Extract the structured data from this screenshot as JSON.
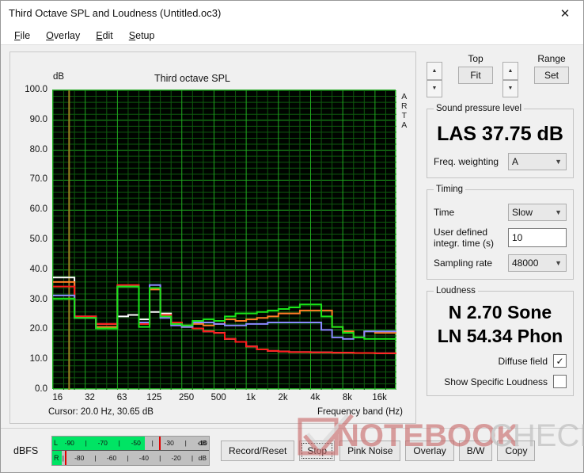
{
  "window": {
    "title": "Third Octave SPL and Loudness (Untitled.oc3)",
    "close_icon": "close-icon",
    "close_glyph": "✕"
  },
  "menu": {
    "items": [
      {
        "accel": "F",
        "rest": "ile"
      },
      {
        "accel": "O",
        "rest": "verlay"
      },
      {
        "accel": "E",
        "rest": "dit"
      },
      {
        "accel": "S",
        "rest": "etup"
      }
    ]
  },
  "graph": {
    "title": "Third octave SPL",
    "y_unit": "dB",
    "watermark_text": "ARTA",
    "cursor_label": "Cursor:   20.0 Hz, 30.65 dB",
    "x_axis_label": "Frequency band (Hz)"
  },
  "controls": {
    "top": {
      "label": "Top",
      "button": "Fit",
      "up_icon": "spinner-up-icon",
      "down_icon": "spinner-down-icon"
    },
    "range": {
      "label": "Range",
      "button": "Set",
      "up_icon": "spinner-up-icon",
      "down_icon": "spinner-down-icon"
    },
    "spl": {
      "legend": "Sound pressure level",
      "value": "LAS 37.75 dB",
      "weighting_label": "Freq. weighting",
      "weighting_value": "A"
    },
    "timing": {
      "legend": "Timing",
      "time_label": "Time",
      "time_value": "Slow",
      "integr_label": "User defined integr. time (s)",
      "integr_value": "10",
      "sampling_label": "Sampling rate",
      "sampling_value": "48000"
    },
    "loudness": {
      "legend": "Loudness",
      "sone": "N 2.70 Sone",
      "phon": "LN 54.34 Phon",
      "diffuse_label": "Diffuse field",
      "diffuse_checked": "✓",
      "specific_label": "Show Specific Loudness",
      "specific_checked": ""
    }
  },
  "meter": {
    "label": "dBFS",
    "left_channel": "L",
    "right_channel": "R",
    "unit": "dB",
    "top_ticks": [
      "-90",
      "|",
      "-70",
      "|",
      "-50",
      "|",
      "-30",
      "|",
      "-10"
    ],
    "bottom_ticks": [
      "|",
      "-80",
      "|",
      "-60",
      "|",
      "-40",
      "|",
      "-20",
      "|"
    ],
    "left_fill_pct": 59,
    "left_peak_pct": 68,
    "right_fill_pct": 6,
    "right_peak_pct": 8
  },
  "buttons": [
    {
      "label": "Record/Reset",
      "focused": false
    },
    {
      "label": "Stop",
      "focused": true
    },
    {
      "label": "Pink Noise",
      "focused": false
    },
    {
      "label": "Overlay",
      "focused": false
    },
    {
      "label": "B/W",
      "focused": false
    },
    {
      "label": "Copy",
      "focused": false
    }
  ],
  "colors": {
    "plot_bg": "#000500",
    "grid_major": "#1fa81f",
    "grid_minor": "#0e5a0e",
    "cursor_line": "#9a8420",
    "series_white": "#ffffff",
    "series_orange": "#ff7d26",
    "series_red": "#ff1a1a",
    "series_blue": "#8a8aff",
    "series_green": "#19e519",
    "meter_green": "#00e464",
    "meter_peak": "#e00000"
  },
  "chart_data": {
    "type": "line",
    "title": "Third octave SPL",
    "xlabel": "Frequency band (Hz)",
    "ylabel": "dB",
    "ylim": [
      0,
      100
    ],
    "ytick_step": 10,
    "yticks": [
      "0.0",
      "10.0",
      "20.0",
      "30.0",
      "40.0",
      "50.0",
      "60.0",
      "70.0",
      "80.0",
      "90.0",
      "100.0"
    ],
    "xticks": [
      "16",
      "32",
      "63",
      "125",
      "250",
      "500",
      "1k",
      "2k",
      "4k",
      "8k",
      "16k"
    ],
    "grid": true,
    "legend": null,
    "step_plot": true,
    "cursor": {
      "freq_hz": 20.0,
      "level_db": 30.65
    },
    "bands_hz": [
      16,
      20,
      25,
      31.5,
      40,
      50,
      63,
      80,
      100,
      125,
      160,
      200,
      250,
      315,
      400,
      500,
      630,
      800,
      1000,
      1250,
      1600,
      2000,
      2500,
      3150,
      4000,
      5000,
      6300,
      8000,
      10000,
      12500,
      16000,
      20000
    ],
    "series": [
      {
        "name": "white",
        "color": "#ffffff",
        "values": [
          37.5,
          37.5,
          24.5,
          24.5,
          22.0,
          22.0,
          24.5,
          25.0,
          23.5,
          26.0,
          25.5,
          22.5,
          21.0,
          20.5,
          19.5,
          19.0,
          17.0,
          16.0,
          14.5,
          13.5,
          13.0,
          12.8,
          12.6,
          12.6,
          12.5,
          12.5,
          12.4,
          12.4,
          12.3,
          12.3,
          12.2,
          12.2
        ]
      },
      {
        "name": "orange",
        "color": "#ff7d26",
        "values": [
          36.0,
          36.0,
          24.0,
          24.0,
          21.0,
          21.0,
          34.5,
          34.5,
          22.0,
          33.5,
          24.5,
          22.0,
          21.5,
          22.0,
          21.5,
          22.0,
          23.5,
          23.0,
          23.5,
          24.0,
          24.5,
          25.5,
          25.5,
          26.5,
          26.5,
          26.5,
          21.0,
          19.5,
          17.5,
          19.5,
          19.0,
          19.0
        ]
      },
      {
        "name": "red",
        "color": "#ff1a1a",
        "values": [
          34.5,
          34.5,
          24.5,
          24.5,
          22.0,
          22.0,
          35.0,
          35.0,
          22.0,
          34.0,
          25.0,
          22.5,
          21.0,
          20.5,
          19.5,
          19.0,
          17.0,
          16.0,
          14.5,
          13.5,
          13.0,
          12.8,
          12.6,
          12.6,
          12.5,
          12.5,
          12.4,
          12.4,
          12.3,
          12.3,
          12.2,
          12.2
        ]
      },
      {
        "name": "blue",
        "color": "#8a8aff",
        "values": [
          31.5,
          31.5,
          24.0,
          24.0,
          20.5,
          20.5,
          34.5,
          34.5,
          22.5,
          35.0,
          24.0,
          21.5,
          21.0,
          22.5,
          22.5,
          22.0,
          21.5,
          21.5,
          22.0,
          22.0,
          22.5,
          22.5,
          22.5,
          22.5,
          22.5,
          20.0,
          17.5,
          17.0,
          17.5,
          19.5,
          19.5,
          19.5
        ]
      },
      {
        "name": "green",
        "color": "#19e519",
        "values": [
          30.5,
          30.5,
          24.0,
          24.0,
          20.5,
          20.5,
          34.5,
          34.5,
          21.0,
          34.0,
          24.5,
          22.0,
          21.5,
          23.0,
          23.5,
          23.0,
          24.5,
          25.5,
          25.5,
          26.0,
          26.5,
          27.0,
          27.5,
          28.5,
          28.5,
          24.5,
          21.0,
          19.0,
          17.5,
          17.0,
          17.0,
          17.0
        ]
      }
    ]
  }
}
